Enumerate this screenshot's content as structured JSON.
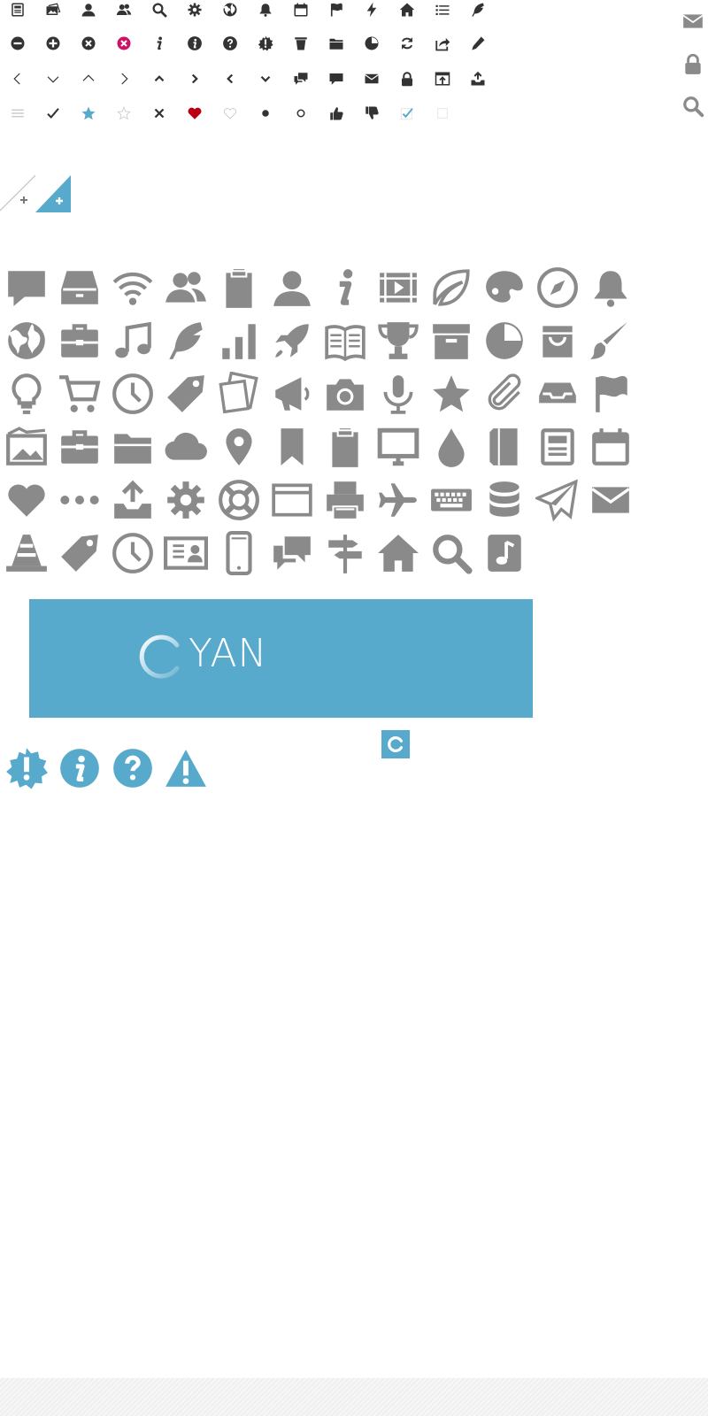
{
  "colors": {
    "dark": "#333333",
    "gray": "#8a8a8a",
    "accent": "#57aacc",
    "magenta": "#cc1166",
    "heart": "#bb0011",
    "light": "#cccccc"
  },
  "small_icon_rows": [
    [
      "newspaper-icon",
      "pictures-icon",
      "user-icon",
      "users-icon",
      "search-icon",
      "gear-icon",
      "globe-icon",
      "bell-icon",
      "calendar-icon",
      "flag-icon",
      "bolt-icon",
      "home-icon",
      "list-icon",
      "feather-icon"
    ],
    [
      "minus-circle-icon",
      "plus-circle-icon",
      "close-circle-icon",
      "close-circle-red-icon",
      "info-icon",
      "info-circle-icon",
      "question-circle-icon",
      "alert-badge-icon",
      "trash-icon",
      "folder-icon",
      "pie-chart-icon",
      "refresh-icon",
      "share-icon",
      "pencil-icon"
    ],
    [
      "chevron-left-thin-icon",
      "chevron-down-thin-icon",
      "chevron-up-thin-icon",
      "chevron-right-thin-icon",
      "chevron-up-icon",
      "chevron-right-icon",
      "chevron-left-icon",
      "chevron-down-icon",
      "chat-bubbles-icon",
      "chat-bubble-icon",
      "envelope-icon",
      "lock-icon",
      "upload-box-icon",
      "inbox-upload-icon"
    ],
    [
      "drag-handle-icon",
      "checkmark-icon",
      "star-filled-icon",
      "star-outline-icon",
      "close-x-icon",
      "heart-filled-icon",
      "heart-outline-icon",
      "radio-filled-icon",
      "radio-empty-icon",
      "thumbs-up-icon",
      "thumbs-down-icon",
      "checkbox-checked-icon",
      "checkbox-empty-icon"
    ]
  ],
  "side_icons": [
    "envelope-icon",
    "lock-icon",
    "search-icon"
  ],
  "corner_buttons": {
    "plain": "corner-add-plain-icon",
    "blue": "corner-add-blue-icon"
  },
  "big_icon_rows": [
    [
      "speech-bubble-icon",
      "inbox-tray-icon",
      "wifi-icon",
      "users-icon",
      "clipboard-icon",
      "user-icon",
      "info-icon",
      "video-icon",
      "leaf-icon",
      "palette-icon",
      "compass-icon",
      "bell-icon"
    ],
    [
      "globe-icon",
      "briefcase-icon",
      "music-icon",
      "feather-icon",
      "bar-chart-icon",
      "rocket-icon",
      "book-icon",
      "trophy-icon",
      "archive-box-icon",
      "pie-chart-icon",
      "shopping-bag-icon",
      "brush-icon"
    ],
    [
      "lightbulb-icon",
      "cart-icon",
      "clock-icon",
      "price-tag-icon",
      "photos-icon",
      "megaphone-icon",
      "camera-icon",
      "microphone-icon",
      "star-icon",
      "paperclip-icon",
      "tray-icon",
      "flag-icon"
    ],
    [
      "landscape-image-icon",
      "toolbox-icon",
      "folder-open-icon",
      "cloud-icon",
      "map-pin-icon",
      "bookmark-icon",
      "clipboard-icon",
      "monitor-icon",
      "drop-icon",
      "notebook-icon",
      "newspaper-icon",
      "calendar-icon"
    ],
    [
      "heart-icon",
      "more-dots-icon",
      "upload-tray-icon",
      "gear-icon",
      "lifebuoy-icon",
      "browser-window-icon",
      "printer-icon",
      "airplane-icon",
      "keyboard-icon",
      "database-icon",
      "paper-plane-icon",
      "envelope-icon"
    ],
    [
      "traffic-cone-icon",
      "tag-icon",
      "clock-icon",
      "contact-card-icon",
      "mobile-phone-icon",
      "chat-bubbles-icon",
      "signpost-icon",
      "home-icon",
      "search-icon",
      "music-note-icon"
    ]
  ],
  "banner": {
    "logo_text": "YAN"
  },
  "small_logo_icon": "cyan-logo-small-icon",
  "alert_icons": [
    "alert-badge-icon",
    "info-circle-icon",
    "question-circle-icon",
    "warning-triangle-icon"
  ]
}
